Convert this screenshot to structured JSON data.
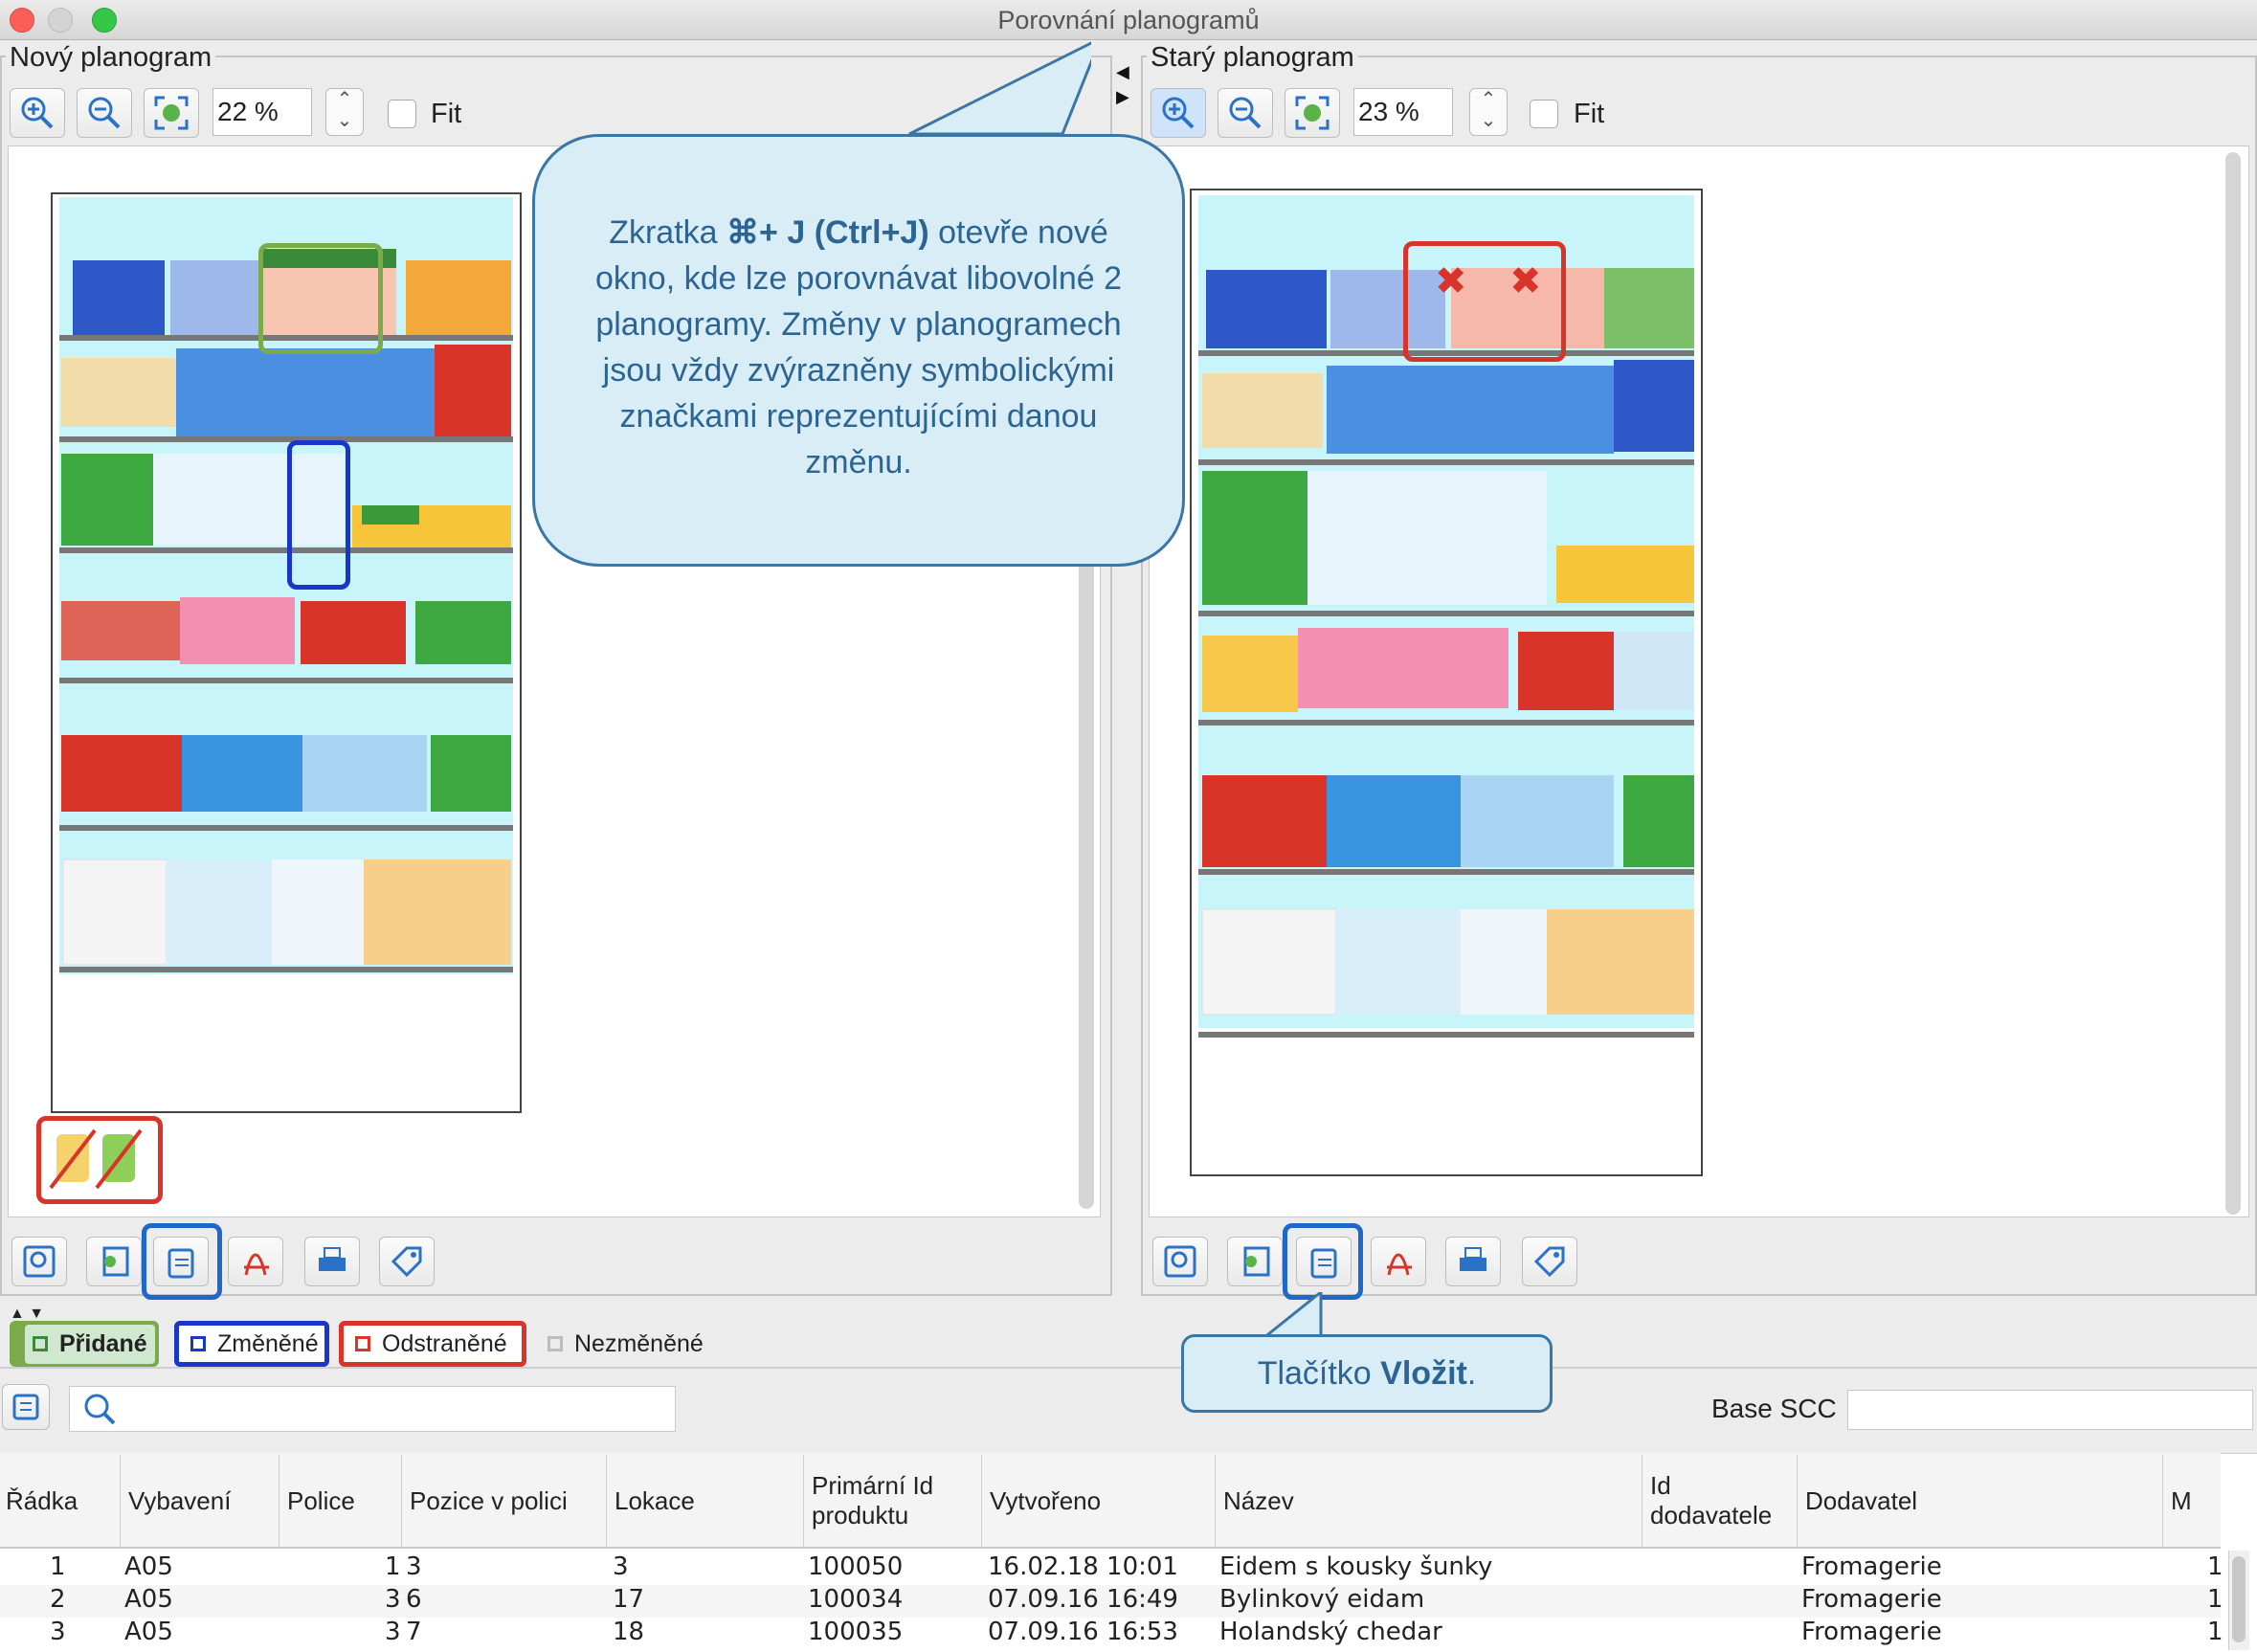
{
  "window": {
    "title": "Porovnání planogramů"
  },
  "left_panel": {
    "label": "Nový planogram",
    "zoom": "22 %",
    "fit_label": "Fit"
  },
  "right_panel": {
    "label": "Starý planogram",
    "zoom": "23 %",
    "fit_label": "Fit"
  },
  "callouts": {
    "main_parts": [
      "Zkratka ",
      "⌘+ J (Ctrl+J)",
      " otevře nové okno, kde lze porovnávat libovolné 2 planogramy. Změny v planogramech jsou vždy zvýrazněny symbolickými značkami reprezentujícími danou změnu."
    ],
    "button_prefix": "Tlačítko ",
    "button_bold": "Vložit",
    "button_suffix": "."
  },
  "filter_tabs": {
    "added": "Přidané",
    "changed": "Změněné",
    "removed": "Odstraněné",
    "unchanged": "Nezměněné"
  },
  "search": {
    "placeholder": ""
  },
  "base_scc": {
    "label": "Base SCC",
    "value": ""
  },
  "table": {
    "headers": [
      "Řádka",
      "Vybavení",
      "Police",
      "Pozice v polici",
      "Lokace",
      "Primární Id produktu",
      "Vytvořeno",
      "Název",
      "Id dodavatele",
      "Dodavatel",
      "M"
    ],
    "rows": [
      {
        "radka": "1",
        "vybaveni": "A05",
        "police": "1",
        "pozice": "3",
        "lokace": "3",
        "id": "100050",
        "vytvoreno": "16.02.18 10:01",
        "nazev": "Eidem s kousky šunky",
        "id_dod": "",
        "dodavatel": "Fromagerie",
        "m": "1"
      },
      {
        "radka": "2",
        "vybaveni": "A05",
        "police": "3",
        "pozice": "6",
        "lokace": "17",
        "id": "100034",
        "vytvoreno": "07.09.16 16:49",
        "nazev": "Bylinkový eidam",
        "id_dod": "",
        "dodavatel": "Fromagerie",
        "m": "1"
      },
      {
        "radka": "3",
        "vybaveni": "A05",
        "police": "3",
        "pozice": "7",
        "lokace": "18",
        "id": "100035",
        "vytvoreno": "07.09.16 16:53",
        "nazev": "Holandský chedar",
        "id_dod": "",
        "dodavatel": "Fromagerie",
        "m": "1"
      }
    ]
  },
  "colors": {
    "added": "#7aaa4a",
    "changed": "#1a36c8",
    "removed": "#d8342a",
    "callout_bg": "#d9edf7",
    "callout_border": "#3a76a6",
    "shelf_bg": "#c8f5f9"
  },
  "icons": [
    "zoom-in-icon",
    "zoom-out-icon",
    "fit-to-window-icon",
    "inspect-icon",
    "add-image-icon",
    "paste-icon",
    "pdf-icon",
    "print-icon",
    "price-tag-icon",
    "search-icon",
    "list-icon"
  ]
}
